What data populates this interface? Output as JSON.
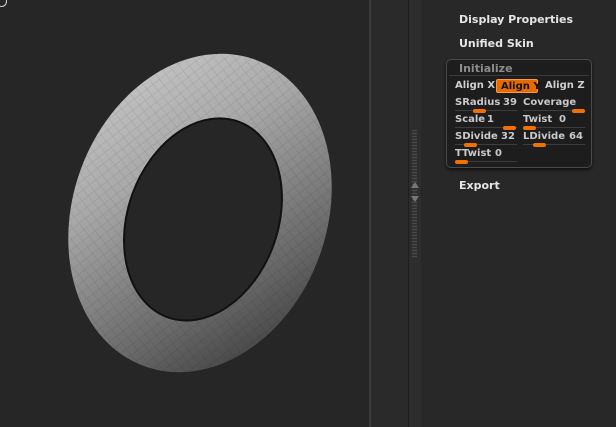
{
  "menu": {
    "display_properties": "Display Properties",
    "unified_skin": "Unified Skin",
    "export": "Export"
  },
  "initialize": {
    "title": "Initialize",
    "align": {
      "x": "Align X",
      "y": "Align Y",
      "z": "Align Z",
      "selected": "Align Y"
    },
    "sliders": {
      "sradius": {
        "label": "SRadius",
        "value": "39"
      },
      "coverage": {
        "label": "Coverage",
        "value": ""
      },
      "scale": {
        "label": "Scale",
        "value": "1"
      },
      "twist": {
        "label": "Twist",
        "value": "0"
      },
      "sdivide": {
        "label": "SDivide",
        "value": "32"
      },
      "ldivide": {
        "label": "LDivide",
        "value": "64"
      },
      "ttwist": {
        "label": "TTwist",
        "value": "0"
      }
    }
  },
  "colors": {
    "accent": "#e56b00",
    "panel_bg": "#282828",
    "viewport_bg": "#262626"
  },
  "icons": {
    "scroll_up": "triangle-up",
    "scroll_down": "triangle-down"
  }
}
